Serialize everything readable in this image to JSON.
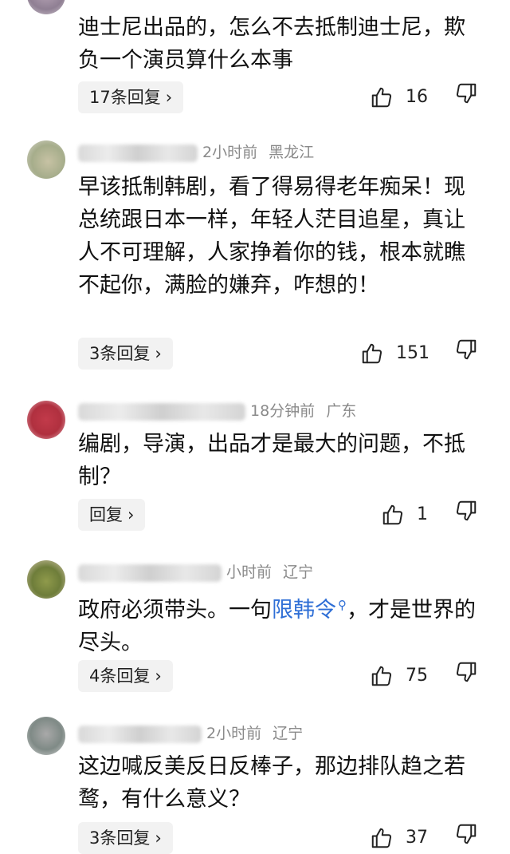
{
  "comments": [
    {
      "meta_name": "",
      "meta_time": "",
      "meta_place": "",
      "text": "迪士尼出品的，怎么不去抵制迪士尼，欺负一个演员算什么本事",
      "reply_label": "17条回复",
      "likes": "16"
    },
    {
      "meta_name": "",
      "meta_time": "2小时前",
      "meta_place": "黑龙江",
      "text": "早该抵制韩剧，看了得易得老年痴呆！现总统跟日本一样，年轻人茫目追星，真让人不可理解，人家挣着你的钱，根本就瞧不起你，满脸的嫌弃，咋想的！",
      "reply_label": "3条回复",
      "likes": "151"
    },
    {
      "meta_name": "",
      "meta_time": "18分钟前",
      "meta_place": "广东",
      "text": "编剧，导演，出品才是最大的问题，不抵制？",
      "reply_label": "回复",
      "likes": "1"
    },
    {
      "meta_name": "",
      "meta_time": "小时前",
      "meta_place": "辽宁",
      "text_before": "政府必须带头。一句",
      "text_link": "限韩令",
      "text_after": "，才是世界的尽头。",
      "reply_label": "4条回复",
      "likes": "75"
    },
    {
      "meta_name": "",
      "meta_time": "2小时前",
      "meta_place": "辽宁",
      "text": "这边喊反美反日反棒子，那边排队趋之若鹜，有什么意义？",
      "reply_label": "3条回复",
      "likes": "37"
    }
  ],
  "icons": {
    "like": "thumbs-up-icon",
    "dislike": "thumbs-down-icon",
    "search": "search-icon",
    "chevron": "chevron-right-icon"
  },
  "colors": {
    "link": "#2f6fd6",
    "meta": "#8a8a8a",
    "reply_bg": "#f2f2f2"
  }
}
